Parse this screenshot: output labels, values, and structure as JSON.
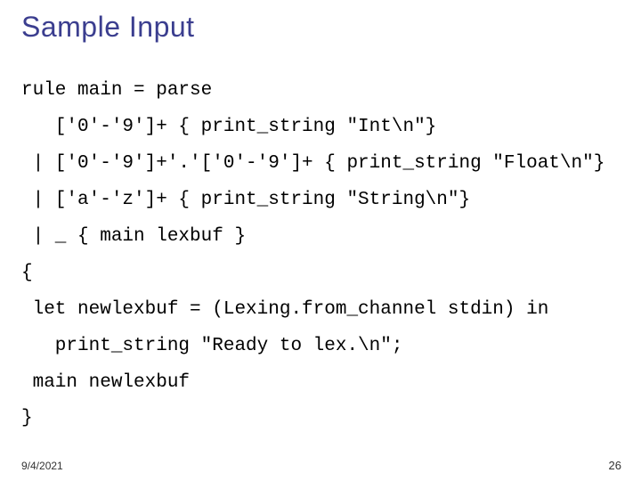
{
  "slide": {
    "title": "Sample Input",
    "code": [
      "rule main = parse",
      "   ['0'-'9']+ { print_string \"Int\\n\"}",
      " | ['0'-'9']+'.'['0'-'9']+ { print_string \"Float\\n\"}",
      " | ['a'-'z']+ { print_string \"String\\n\"}",
      " | _ { main lexbuf }",
      "{",
      " let newlexbuf = (Lexing.from_channel stdin) in",
      "   print_string \"Ready to lex.\\n\";",
      " main newlexbuf",
      "}"
    ],
    "footer_date": "9/4/2021",
    "footer_page": "26"
  }
}
